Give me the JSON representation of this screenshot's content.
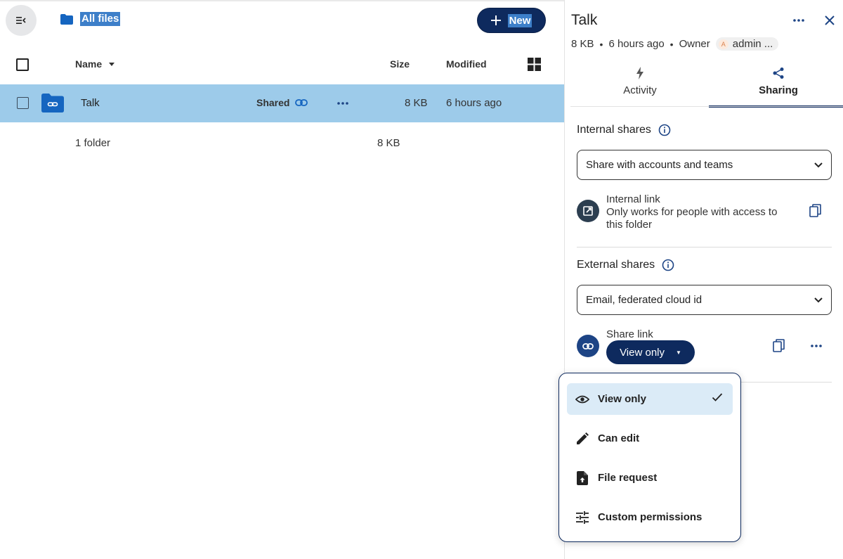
{
  "breadcrumb": {
    "label": "All files"
  },
  "toolbar": {
    "new_label": "New"
  },
  "table": {
    "headers": {
      "name": "Name",
      "size": "Size",
      "modified": "Modified"
    },
    "rows": [
      {
        "name": "Talk",
        "shared_label": "Shared",
        "size": "8 KB",
        "modified": "6 hours ago"
      }
    ],
    "summary": {
      "folders": "1 folder",
      "size": "8 KB"
    }
  },
  "sidebar": {
    "title": "Talk",
    "meta": {
      "size": "8 KB",
      "time": "6 hours ago",
      "owner_label": "Owner",
      "owner_initial": "A",
      "owner_name": "admin ..."
    },
    "tabs": [
      {
        "label": "Activity",
        "icon": "lightning-icon",
        "active": false
      },
      {
        "label": "Sharing",
        "icon": "share-icon",
        "active": true
      }
    ],
    "internal": {
      "title": "Internal shares",
      "select_value": "Share with accounts and teams",
      "link_title": "Internal link",
      "link_desc_1": "Only works for people with access to",
      "link_desc_2": "this folder"
    },
    "external": {
      "title": "External shares",
      "select_value": "Email, federated cloud id",
      "share_link_label": "Share link",
      "permission": "View only"
    }
  },
  "menu": {
    "items": [
      {
        "label": "View only",
        "icon": "eye-icon",
        "selected": true
      },
      {
        "label": "Can edit",
        "icon": "pencil-icon",
        "selected": false
      },
      {
        "label": "File request",
        "icon": "file-upload-icon",
        "selected": false
      },
      {
        "label": "Custom permissions",
        "icon": "tune-icon",
        "selected": false
      }
    ]
  },
  "colors": {
    "primary": "#0e2a5e",
    "selection": "#9dcbea",
    "folder": "#1565c0",
    "menu_selected": "#dbebf7"
  }
}
